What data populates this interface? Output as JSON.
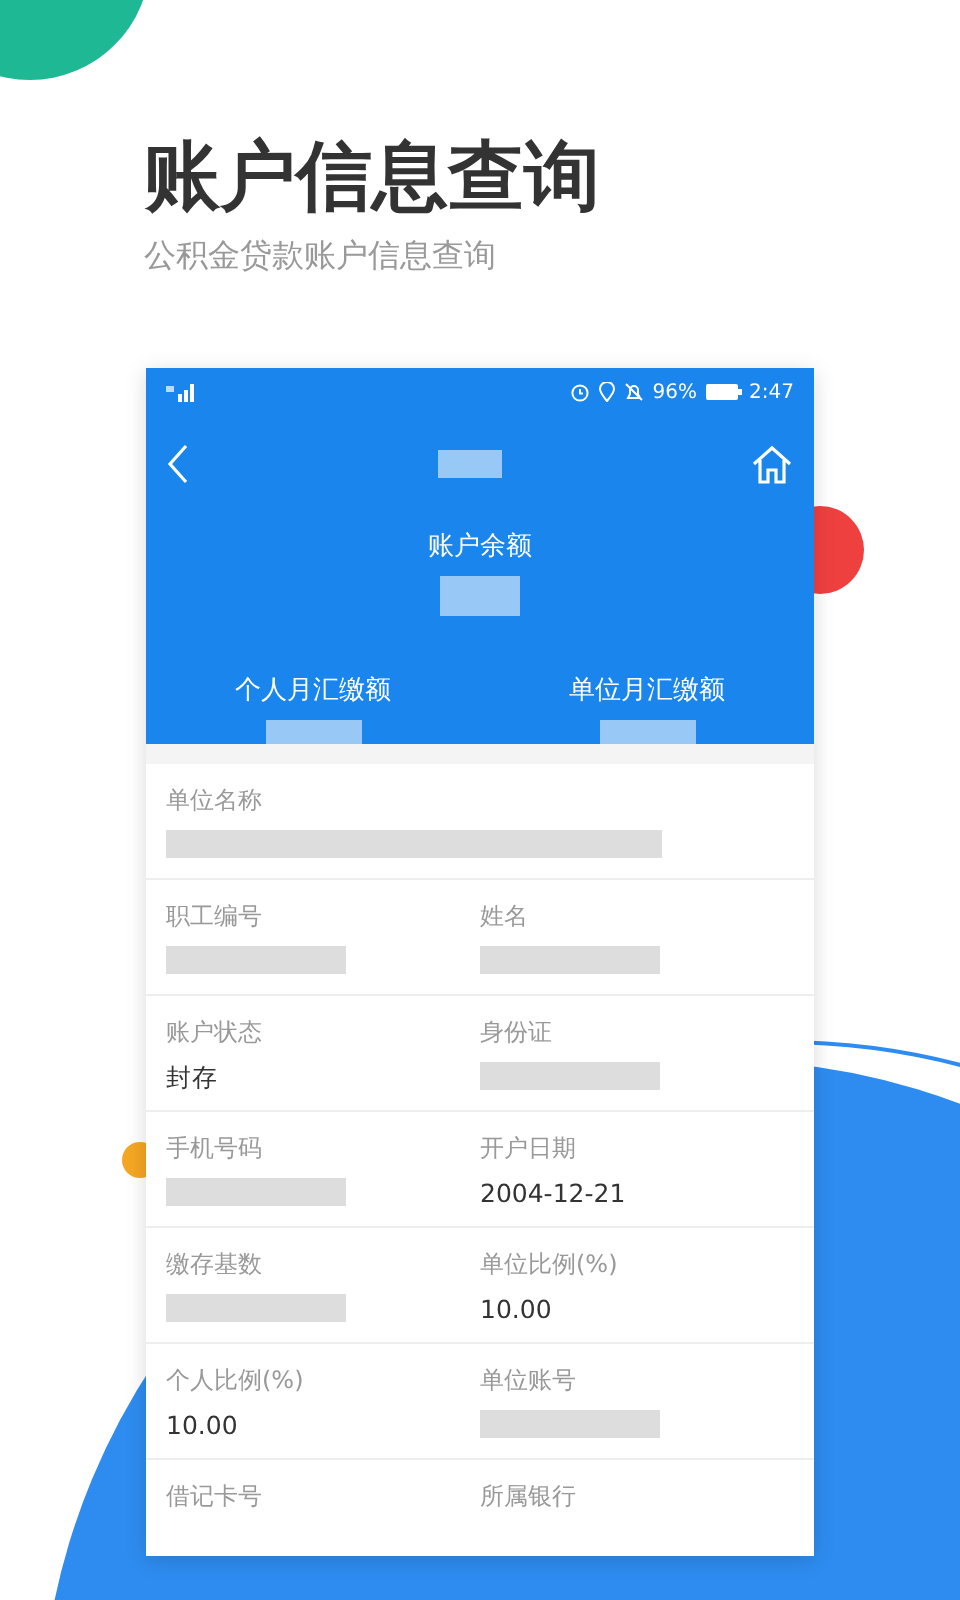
{
  "title": "账户信息查询",
  "subtitle": "公积金贷款账户信息查询",
  "phone": {
    "status_bar": {
      "battery": "96%",
      "time": "2:47"
    },
    "header": {
      "balance_label": "账户余额",
      "contributions": [
        {
          "label": "个人月汇缴额"
        },
        {
          "label": "单位月汇缴额"
        }
      ]
    },
    "rows": [
      {
        "cells": [
          {
            "label": "单位名称",
            "kind": "blurred"
          }
        ]
      },
      {
        "cells": [
          {
            "label": "职工编号",
            "kind": "blurred"
          },
          {
            "label": "姓名",
            "kind": "blurred"
          }
        ]
      },
      {
        "cells": [
          {
            "label": "账户状态",
            "kind": "text",
            "value": "封存"
          },
          {
            "label": "身份证",
            "kind": "blurred"
          }
        ]
      },
      {
        "cells": [
          {
            "label": "手机号码",
            "kind": "blurred"
          },
          {
            "label": "开户日期",
            "kind": "text",
            "value": "2004-12-21"
          }
        ]
      },
      {
        "cells": [
          {
            "label": "缴存基数",
            "kind": "blurred"
          },
          {
            "label": "单位比例(%)",
            "kind": "text",
            "value": "10.00"
          }
        ]
      },
      {
        "cells": [
          {
            "label": "个人比例(%)",
            "kind": "text",
            "value": "10.00"
          },
          {
            "label": "单位账号",
            "kind": "blurred"
          }
        ]
      },
      {
        "cells": [
          {
            "label": "借记卡号",
            "kind": "none"
          },
          {
            "label": "所属银行",
            "kind": "none"
          }
        ]
      }
    ]
  }
}
